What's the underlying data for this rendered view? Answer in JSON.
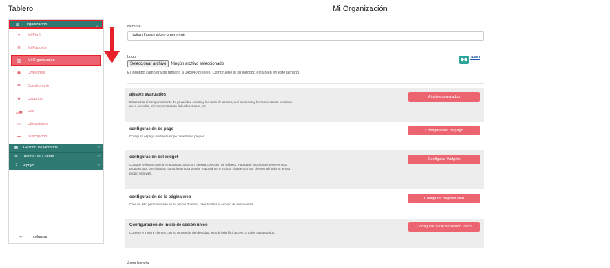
{
  "header": {
    "dashboard_title": "Tablero",
    "page_title": "Mi Organización"
  },
  "sidebar": {
    "groups": [
      {
        "label": "Organización",
        "icon": "building-icon"
      },
      {
        "label": "Gestión De Horarios",
        "icon": "calendar-icon"
      },
      {
        "label": "Textos Del Cliente",
        "icon": "text-icon"
      },
      {
        "label": "Apoyo",
        "icon": "help-icon"
      }
    ],
    "items": [
      {
        "label": "Mi Perfil",
        "icon": "user-icon"
      },
      {
        "label": "Mi Paquete",
        "icon": "package-icon"
      },
      {
        "label": "Mi Organizacion",
        "icon": "building-icon"
      },
      {
        "label": "Divisiones",
        "icon": "sitemap-icon"
      },
      {
        "label": "Cuestionario",
        "icon": "list-icon"
      },
      {
        "label": "Usuarios",
        "icon": "users-icon"
      },
      {
        "label": "Uso",
        "icon": "bar-chart-icon"
      },
      {
        "label": "Ubicaciones",
        "icon": "location-icon"
      },
      {
        "label": "Suscripción",
        "icon": "credit-card-icon"
      }
    ],
    "collapse_label": "colapsar"
  },
  "form": {
    "name_label": "Nombre",
    "name_value": "Italian Demo Webcamconsult",
    "logo_label": "Logo",
    "file_button": "Seleccionar archivo",
    "file_status": "Ningún archivo seleccionado",
    "logo_hint": "El logotipo cambiará de tamaño a 145x40 píxeles. Compruebe si su logotipo está bien en este tamaño.",
    "logo_text": "DEMO",
    "timezone_label": "Zona horaria"
  },
  "panels": [
    {
      "title": "ajustes avanzados",
      "description": "Establezca el comportamiento de privacidad exacto y los roles de acceso, qué opciones y herramientas se permiten en la consulta, el comportamiento del videostream, etc.",
      "button": "Ajustes avanzados"
    },
    {
      "title": "configuración de pago",
      "description": "Configura el pago mediante stripe o mediante paypal.",
      "button": "Configuración de pago"
    },
    {
      "title": "configuración del widget",
      "description": "Coloque webcamconsult en su propio sitio con nuestra colección de widgets; Haga que los clientes reserven sus propias citas, permita una \"consulta sin cita previa\" espontánea e incluso chatee con sus clientes allí mismo, en su propio sitio web.",
      "button": "Configurar Widgets"
    },
    {
      "title": "configuración de la página web",
      "description": "Cree un sitio personalizado en su propio dominio, para facilitar el acceso de sus clientes",
      "button": "Configurar páginas web"
    },
    {
      "title": "Configuración de inicio de sesión único",
      "description": "Conecte e integre clientes con su proveedor de identidad, esto brinda fácil acceso a todos sus usuarios.",
      "button": "Configurar inicio de sesión único"
    }
  ],
  "colors": {
    "sidebar_group": "#2e7a72",
    "accent": "#ec6470",
    "highlight_border": "#e8202a"
  }
}
